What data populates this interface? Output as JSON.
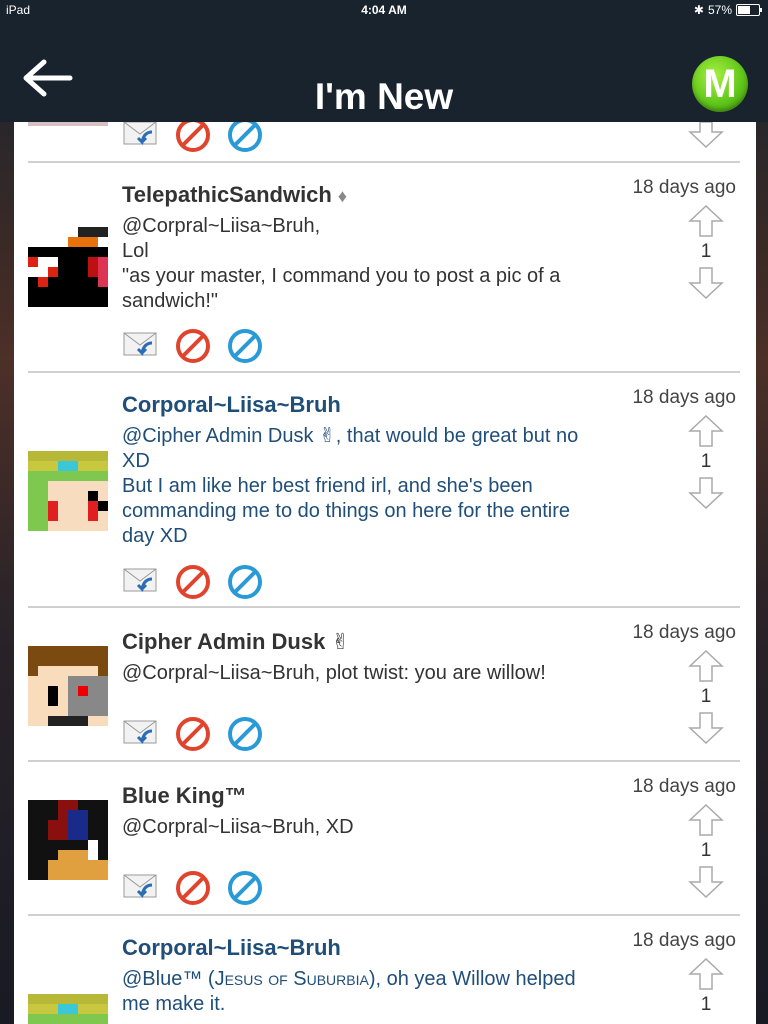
{
  "status_bar": {
    "device": "iPad",
    "time": "4:04 AM",
    "battery": "57%"
  },
  "nav": {
    "title": "I'm New",
    "menu_button_letter": "M",
    "accent": "#5fc21b"
  },
  "comments": [
    {
      "username": "TelepathicSandwich",
      "badge": "♦",
      "timestamp": "18 days ago",
      "lines": [
        "@Corpral~Liisa~Bruh,",
        "Lol",
        "\"as your master, I command you to post a pic of a",
        "sandwich!\""
      ],
      "votes": "1",
      "color": "#333333"
    },
    {
      "username": "Corporal~Liisa~Bruh",
      "badge": "",
      "timestamp": "18 days ago",
      "lines": [
        "@Cipher Admin Dusk ✌, that would be great but no",
        "XD",
        "But I am like her best friend irl, and she's been",
        "commanding me to do things on here for the entire",
        "day XD"
      ],
      "votes": "1",
      "color": "#1f4e79"
    },
    {
      "username": "Cipher Admin Dusk ✌",
      "badge": "",
      "timestamp": "18 days ago",
      "lines": [
        "@Corpral~Liisa~Bruh, plot twist: you are willow!"
      ],
      "votes": "1",
      "color": "#333333"
    },
    {
      "username": "Blue King™",
      "badge": "",
      "timestamp": "18 days ago",
      "lines": [
        "@Corpral~Liisa~Bruh, XD"
      ],
      "votes": "1",
      "color": "#333333"
    },
    {
      "username": "Corporal~Liisa~Bruh",
      "badge": "",
      "timestamp": "18 days ago",
      "line1_a": "@Blue™ (",
      "line1_b": "Jesus of Suburbia",
      "line1_c": "), oh yea Willow helped",
      "line2": "me make it.",
      "votes": "1",
      "color": "#1f4e79"
    }
  ],
  "icons": {
    "reply": "reply-mail-icon",
    "block": "block-icon",
    "report": "report-icon",
    "upvote": "upvote-arrow-icon",
    "downvote": "downvote-arrow-icon"
  }
}
